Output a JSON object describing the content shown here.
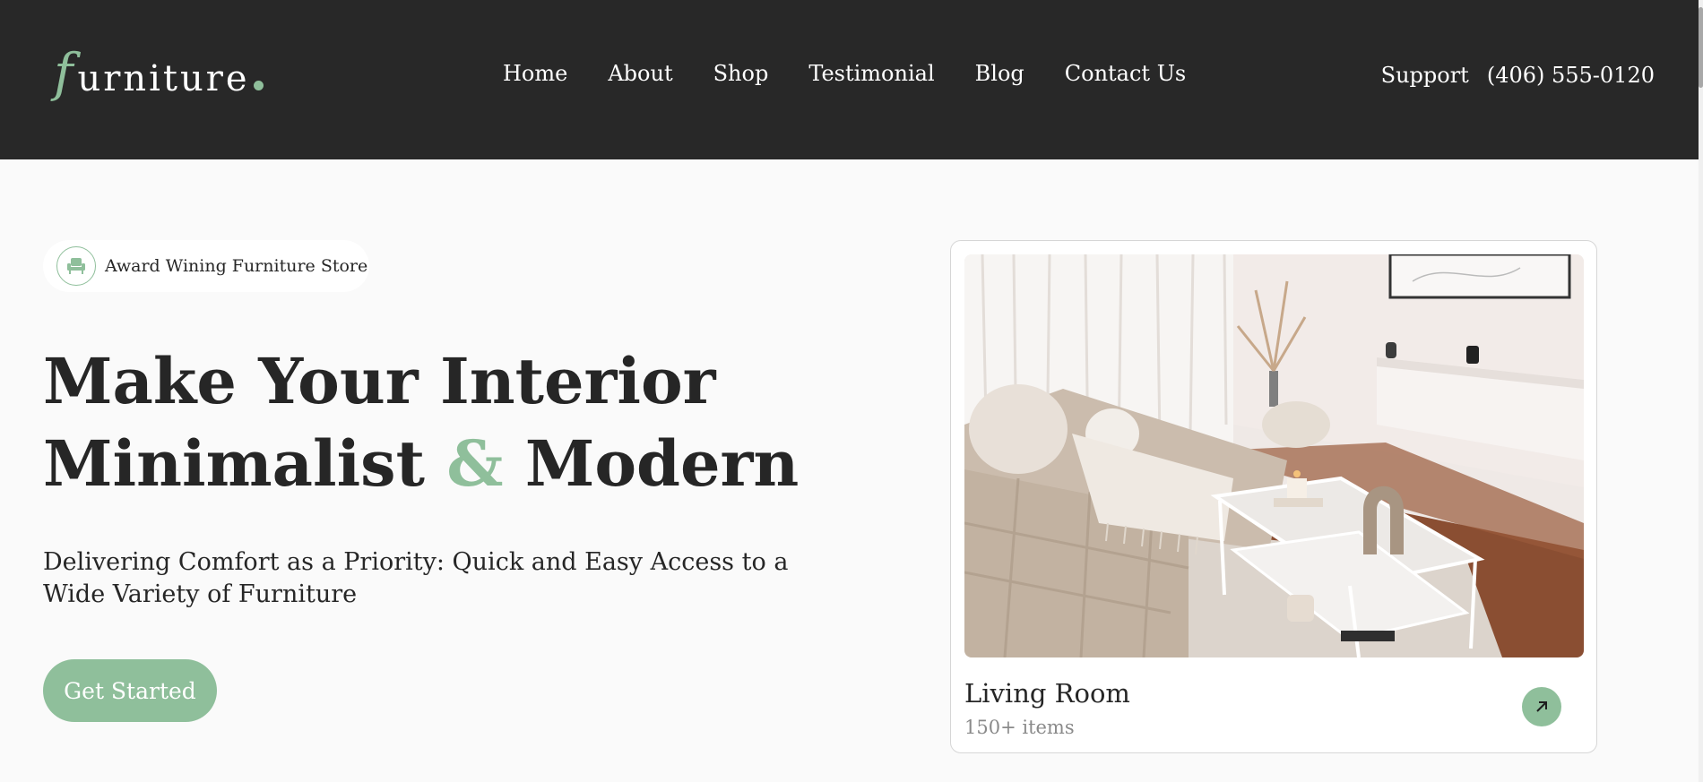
{
  "brand": {
    "logo_initial": "f",
    "logo_rest": "urniture",
    "accent_color": "#8fbf9b",
    "header_bg": "#282828"
  },
  "nav": {
    "items": [
      "Home",
      "About",
      "Shop",
      "Testimonial",
      "Blog",
      "Contact Us"
    ]
  },
  "support": {
    "label": "Support",
    "phone": "(406) 555-0120"
  },
  "hero": {
    "badge_icon": "armchair-icon",
    "badge_text": "Award Wining Furniture Store",
    "title_line1": "Make Your Interior",
    "title_line2_a": "Minimalist",
    "title_amp": "&",
    "title_line2_b": "Modern",
    "description": "Delivering Comfort as a Priority: Quick and Easy Access to a Wide Variety of Furniture",
    "cta_label": "Get Started"
  },
  "category_card": {
    "title": "Living Room",
    "subtitle": "150+ items",
    "arrow_icon": "arrow-up-right-icon"
  }
}
